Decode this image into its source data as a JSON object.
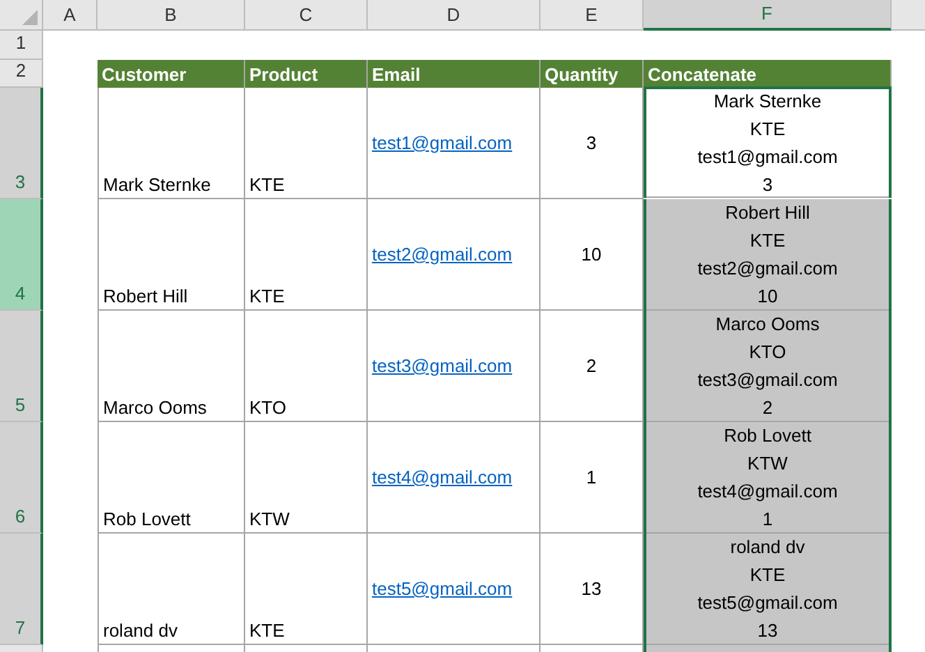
{
  "columns": [
    {
      "label": "A",
      "selected": false
    },
    {
      "label": "B",
      "selected": false
    },
    {
      "label": "C",
      "selected": false
    },
    {
      "label": "D",
      "selected": false
    },
    {
      "label": "E",
      "selected": false
    },
    {
      "label": "F",
      "selected": true
    }
  ],
  "row_headers": [
    {
      "label": "1",
      "selected": false,
      "active": false
    },
    {
      "label": "2",
      "selected": false,
      "active": false
    },
    {
      "label": "3",
      "selected": true,
      "active": false
    },
    {
      "label": "4",
      "selected": true,
      "active": true
    },
    {
      "label": "5",
      "selected": true,
      "active": false
    },
    {
      "label": "6",
      "selected": true,
      "active": false
    },
    {
      "label": "7",
      "selected": true,
      "active": false
    }
  ],
  "table_header": [
    "Customer",
    "Product",
    "Email",
    "Quantity",
    "Concatenate"
  ],
  "records": [
    {
      "customer": "Mark Sternke",
      "product": "KTE",
      "email": "test1@gmail.com",
      "quantity": "3",
      "concatenate": [
        "Mark Sternke",
        "KTE",
        "test1@gmail.com",
        "3"
      ],
      "selected": false
    },
    {
      "customer": "Robert Hill",
      "product": "KTE",
      "email": "test2@gmail.com",
      "quantity": "10",
      "concatenate": [
        "Robert Hill",
        "KTE",
        "test2@gmail.com",
        "10"
      ],
      "selected": true
    },
    {
      "customer": "Marco Ooms",
      "product": "KTO",
      "email": "test3@gmail.com",
      "quantity": "2",
      "concatenate": [
        "Marco Ooms",
        "KTO",
        "test3@gmail.com",
        "2"
      ],
      "selected": true
    },
    {
      "customer": "Rob Lovett",
      "product": "KTW",
      "email": "test4@gmail.com",
      "quantity": "1",
      "concatenate": [
        "Rob Lovett",
        "KTW",
        "test4@gmail.com",
        "1"
      ],
      "selected": true
    },
    {
      "customer": "roland dv",
      "product": "KTE",
      "email": "test5@gmail.com",
      "quantity": "13",
      "concatenate": [
        "roland dv",
        "KTE",
        "test5@gmail.com",
        "13"
      ],
      "selected": true
    }
  ]
}
